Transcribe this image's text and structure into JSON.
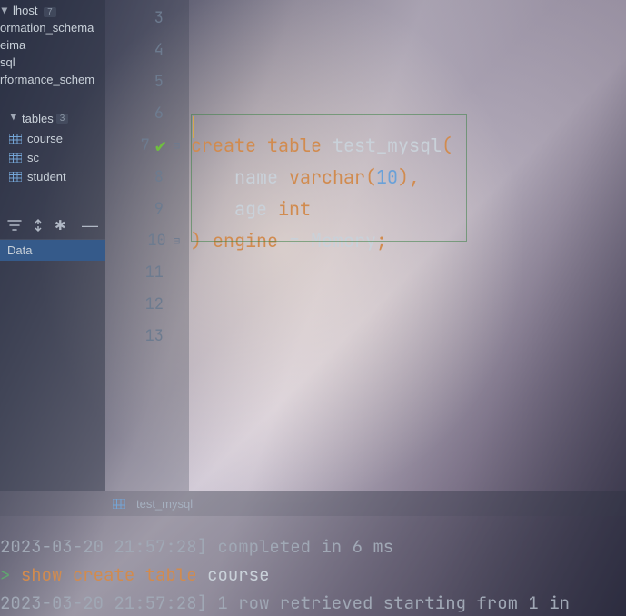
{
  "sidebar": {
    "databases": [
      {
        "name": "lhost",
        "count": "7"
      },
      {
        "name": "ormation_schema"
      },
      {
        "name": "eima"
      },
      {
        "name": "sql"
      },
      {
        "name": "rformance_schem"
      }
    ],
    "tables_header": {
      "label": "tables",
      "count": "3"
    },
    "tables": [
      "course",
      "sc",
      "student"
    ],
    "data_tab": "Data"
  },
  "editor": {
    "lines": [
      {
        "n": "3"
      },
      {
        "n": "4"
      },
      {
        "n": "5"
      },
      {
        "n": "6"
      },
      {
        "n": "7"
      },
      {
        "n": "8"
      },
      {
        "n": "9"
      },
      {
        "n": "10"
      },
      {
        "n": "11"
      },
      {
        "n": "12"
      },
      {
        "n": "13"
      }
    ],
    "code": {
      "l7": {
        "t0": "create",
        "t1": "table",
        "t2": "test_mysql",
        "t3": "("
      },
      "l8": {
        "indent": "    ",
        "t0": "name",
        "t1": "varchar",
        "t2": "(",
        "t3": "10",
        "t4": ")",
        "t5": ","
      },
      "l9": {
        "indent": "    ",
        "t0": "age",
        "t1": "int"
      },
      "l10": {
        "t0": ")",
        "t1": "engine",
        "t2": "=",
        "t3": "Memory",
        "t4": ";"
      }
    }
  },
  "tabbar": {
    "tabs": [
      {
        "label": "test_mysql"
      }
    ]
  },
  "console": {
    "lines": [
      {
        "text": "2023-03-20 21:57:28] completed in 6 ms"
      },
      {
        "prompt": ">",
        "t0": "show",
        "t1": "create",
        "t2": "table",
        "t3": "course"
      },
      {
        "text": "2023-03-20 21:57:28] 1 row retrieved starting from 1 in"
      }
    ]
  }
}
